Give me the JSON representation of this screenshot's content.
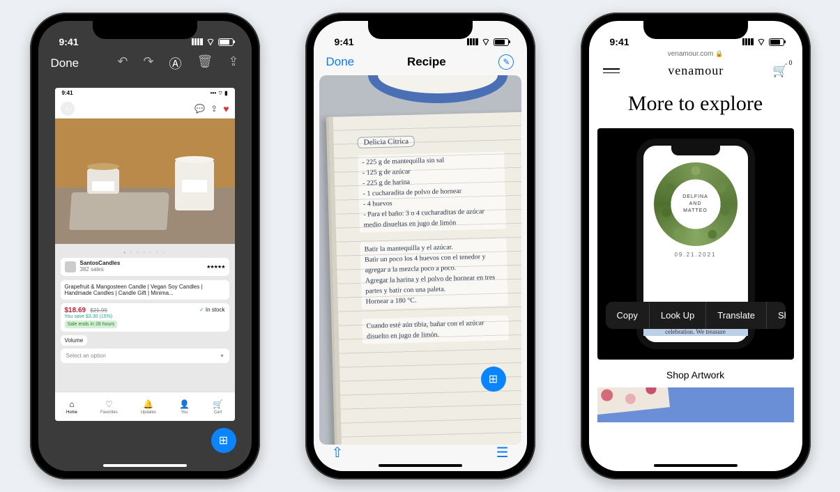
{
  "status_time": "9:41",
  "phone1": {
    "toolbar": {
      "done": "Done"
    },
    "inner": {
      "time": "9:41",
      "seller_name": "SantosCandles",
      "seller_sub": "382 sales",
      "stars": "★★★★★",
      "product_title": "Grapefruit & Mangosteen Candle | Vegan Soy Candles | Handmade Candles | Candle Gift | Minima...",
      "price": "$18.69",
      "old_price": "$21.99",
      "in_stock": "In stock",
      "you_save": "You save $3.30 (15%)",
      "sale_ends": "Sale ends in 28 hours",
      "volume_label": "Volume",
      "select_placeholder": "Select an option",
      "tabs": {
        "home": "Home",
        "favorites": "Favorites",
        "updates": "Updates",
        "you": "You",
        "cart": "Cart"
      }
    }
  },
  "phone2": {
    "done": "Done",
    "title": "Recipe",
    "recipe_title": "Delicia Cítrica",
    "block1": "- 225 g de mantequilla sin sal\n- 125 g de azúcar\n- 225 g de harina\n- 1 cucharadita de polvo de hornear\n- 4 huevos\n- Para el baño: 3 o 4 cucharaditas de azúcar medio disueltas en jugo de limón",
    "block2": "Batir la mantequilla y el azúcar.\nBatir un poco los 4 huevos con el tenedor y agregar a la mezcla poco a poco.\nAgregar la harina y el polvo de hornear en tres partes y batir con una paleta.\nHornear a 180 °C.",
    "block3": "Cuando esté aún tibia, bañar con el azúcar disuelto en jugo de limón."
  },
  "phone3": {
    "url": "venamour.com",
    "logo": "venamour",
    "cart_count": "0",
    "hero": "More to explore",
    "wreath_top": "DELFINA",
    "wreath_mid": "AND",
    "wreath_bot": "MATTEO",
    "mini_date": "09.21.2021",
    "highlight": "We would be delighted by your presence at our intimate wedding celebration. We treasure",
    "menu": {
      "copy": "Copy",
      "lookup": "Look Up",
      "translate": "Translate",
      "share": "Share…"
    },
    "shop": "Shop Artwork"
  }
}
